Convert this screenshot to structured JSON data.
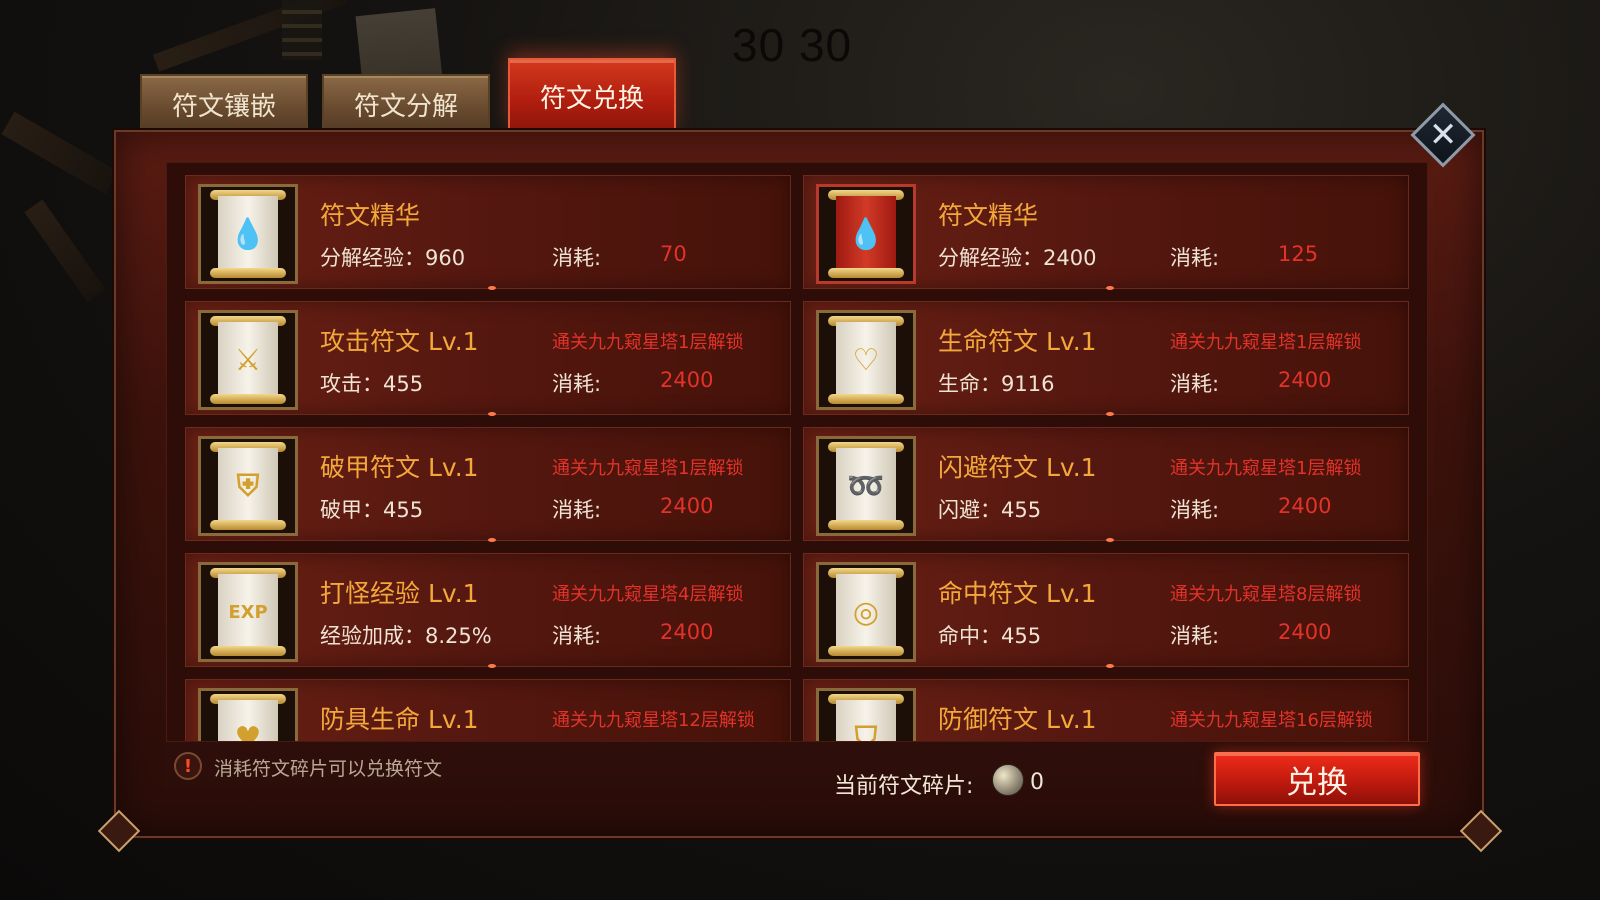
{
  "top_counter": "30 30",
  "tabs": [
    {
      "label": "符文镶嵌",
      "active": false
    },
    {
      "label": "符文分解",
      "active": false
    },
    {
      "label": "符文兑换",
      "active": true
    }
  ],
  "close_label": "✕",
  "runes": [
    {
      "name": "符文精华",
      "stat": "分解经验：960",
      "unlock": "",
      "cost_label": "消耗:",
      "cost": "70",
      "icon": "essence-scroll-icon",
      "rarity": "gold"
    },
    {
      "name": "符文精华",
      "stat": "分解经验：2400",
      "unlock": "",
      "cost_label": "消耗:",
      "cost": "125",
      "icon": "essence-scroll-red-icon",
      "rarity": "red"
    },
    {
      "name": "攻击符文 Lv.1",
      "stat": "攻击：455",
      "unlock": "通关九九窥星塔1层解锁",
      "cost_label": "消耗:",
      "cost": "2400",
      "icon": "attack-rune-icon",
      "rarity": "gold"
    },
    {
      "name": "生命符文 Lv.1",
      "stat": "生命：9116",
      "unlock": "通关九九窥星塔1层解锁",
      "cost_label": "消耗:",
      "cost": "2400",
      "icon": "life-rune-icon",
      "rarity": "gold"
    },
    {
      "name": "破甲符文 Lv.1",
      "stat": "破甲：455",
      "unlock": "通关九九窥星塔1层解锁",
      "cost_label": "消耗:",
      "cost": "2400",
      "icon": "armor-break-rune-icon",
      "rarity": "gold"
    },
    {
      "name": "闪避符文 Lv.1",
      "stat": "闪避：455",
      "unlock": "通关九九窥星塔1层解锁",
      "cost_label": "消耗:",
      "cost": "2400",
      "icon": "dodge-rune-icon",
      "rarity": "gold"
    },
    {
      "name": "打怪经验 Lv.1",
      "stat": "经验加成：8.25%",
      "unlock": "通关九九窥星塔4层解锁",
      "cost_label": "消耗:",
      "cost": "2400",
      "icon": "exp-rune-icon",
      "rarity": "gold"
    },
    {
      "name": "命中符文 Lv.1",
      "stat": "命中：455",
      "unlock": "通关九九窥星塔8层解锁",
      "cost_label": "消耗:",
      "cost": "2400",
      "icon": "hit-rune-icon",
      "rarity": "gold"
    },
    {
      "name": "防具生命 Lv.1",
      "stat": "",
      "unlock": "通关九九窥星塔12层解锁",
      "cost_label": "",
      "cost": "",
      "icon": "armor-life-rune-icon",
      "rarity": "gold"
    },
    {
      "name": "防御符文 Lv.1",
      "stat": "",
      "unlock": "通关九九窥星塔16层解锁",
      "cost_label": "",
      "cost": "",
      "icon": "defense-rune-icon",
      "rarity": "gold"
    }
  ],
  "footer": {
    "hint": "消耗符文碎片可以兑换符文",
    "hint_icon": "!",
    "fragment_label": "当前符文碎片:",
    "fragment_count": "0",
    "exchange_label": "兑换"
  },
  "colors": {
    "accent_orange": "#f4a83a",
    "cost_red": "#e2322a",
    "tab_active": "#c42414",
    "panel_bg": "#4a160e"
  }
}
